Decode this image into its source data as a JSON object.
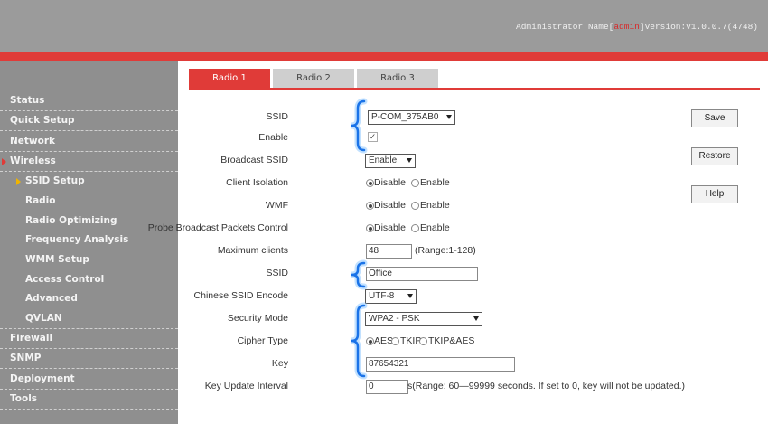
{
  "header": {
    "admin_prefix": "Administrator Name[",
    "admin_user": "admin",
    "admin_suffix": "]Version:V1.0.0.7(4748)"
  },
  "sidebar": {
    "items": [
      {
        "label": "Status"
      },
      {
        "label": "Quick Setup"
      },
      {
        "label": "Network"
      },
      {
        "label": "Wireless"
      },
      {
        "label": "SSID Setup"
      },
      {
        "label": "Radio"
      },
      {
        "label": "Radio Optimizing"
      },
      {
        "label": "Frequency Analysis"
      },
      {
        "label": "WMM Setup"
      },
      {
        "label": "Access Control"
      },
      {
        "label": "Advanced"
      },
      {
        "label": "QVLAN"
      },
      {
        "label": "Firewall"
      },
      {
        "label": "SNMP"
      },
      {
        "label": "Deployment"
      },
      {
        "label": "Tools"
      }
    ]
  },
  "tabs": [
    {
      "label": "Radio 1"
    },
    {
      "label": "Radio 2"
    },
    {
      "label": "Radio 3"
    }
  ],
  "form": {
    "ssid_select": {
      "label": "SSID",
      "value": "P-COM_375AB0"
    },
    "enable": {
      "label": "Enable",
      "checked": true,
      "mark": "✓"
    },
    "broadcast_ssid": {
      "label": "Broadcast SSID",
      "value": "Enable"
    },
    "client_isolation": {
      "label": "Client Isolation",
      "opt1": "Disable",
      "opt2": "Enable"
    },
    "wmf": {
      "label": "WMF",
      "opt1": "Disable",
      "opt2": "Enable"
    },
    "probe": {
      "label": "Probe Broadcast Packets Control",
      "opt1": "Disable",
      "opt2": "Enable"
    },
    "max_clients": {
      "label": "Maximum clients",
      "value": "48",
      "note": "(Range:1-128)"
    },
    "ssid_name": {
      "label": "SSID",
      "value": "Office"
    },
    "chinese_encode": {
      "label": "Chinese SSID Encode",
      "value": "UTF-8"
    },
    "security_mode": {
      "label": "Security Mode",
      "value": "WPA2 - PSK"
    },
    "cipher_type": {
      "label": "Cipher Type",
      "opt1": "AES",
      "opt2": "TKIP",
      "opt3": "TKIP&AES"
    },
    "key": {
      "label": "Key",
      "value": "87654321"
    },
    "key_update": {
      "label": "Key Update Interval",
      "value": "0",
      "note": "s(Range: 60—99999 seconds. If set to 0, key will not be updated.)"
    }
  },
  "buttons": {
    "save": "Save",
    "restore": "Restore",
    "help": "Help"
  },
  "colors": {
    "accent": "#e03b38",
    "highlight": "#1a73e8"
  }
}
